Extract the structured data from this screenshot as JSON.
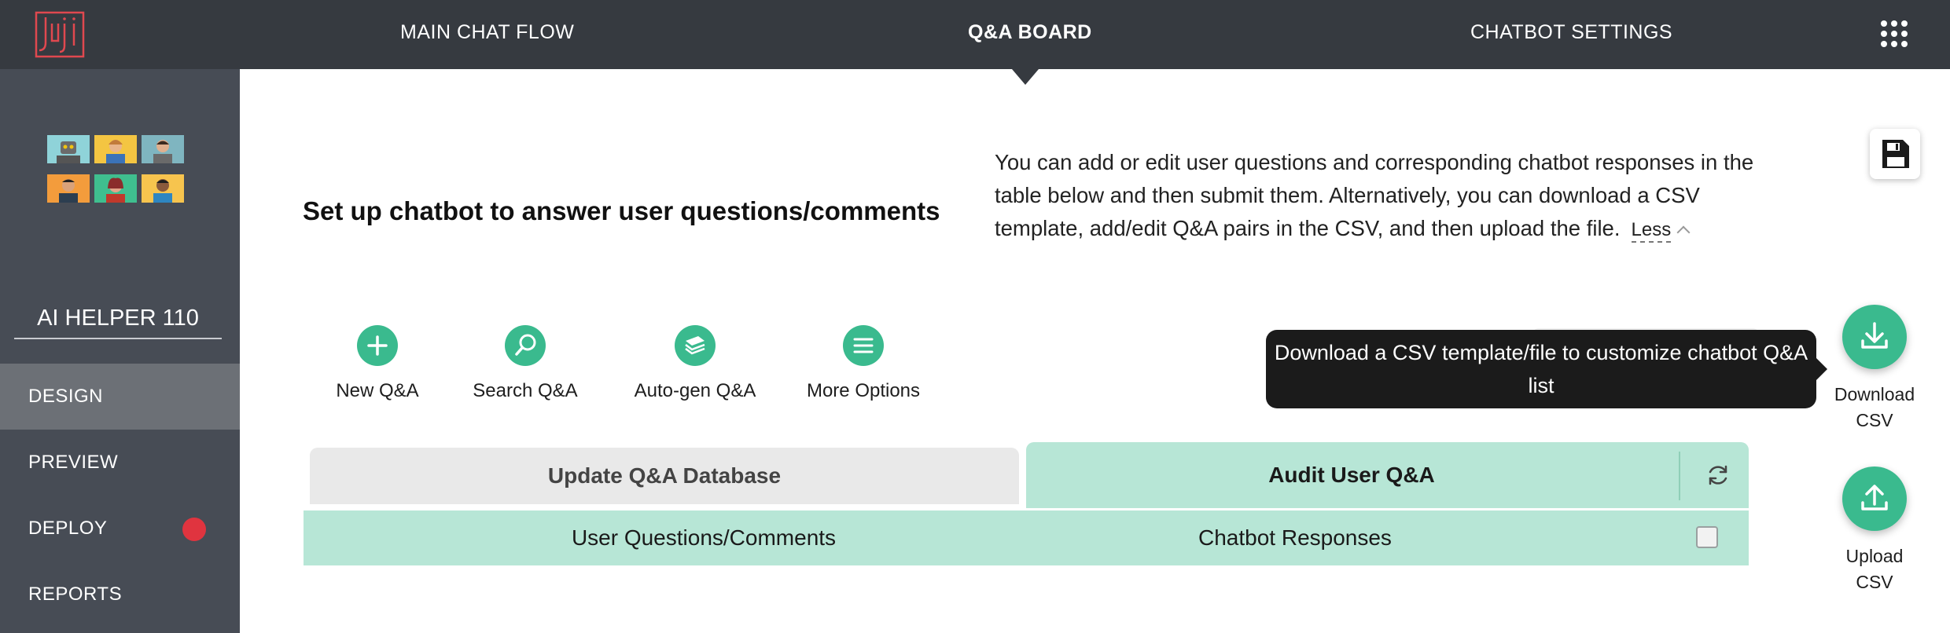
{
  "topbar": {
    "logo_text": "Juji",
    "nav": [
      {
        "label": "MAIN CHAT FLOW"
      },
      {
        "label": "Q&A BOARD"
      },
      {
        "label": "CHATBOT SETTINGS"
      }
    ]
  },
  "sidebar": {
    "bot_name": "AI HELPER 110",
    "items": [
      {
        "label": "DESIGN"
      },
      {
        "label": "PREVIEW"
      },
      {
        "label": "DEPLOY"
      },
      {
        "label": "REPORTS"
      }
    ]
  },
  "main": {
    "heading": "Set up chatbot to answer user questions/comments",
    "description": "You can add or edit user questions and corresponding chatbot responses in the table below and then submit them. Alternatively, you can download a CSV template, add/edit Q&A pairs in the CSV, and then upload the file.",
    "less_label": "Less",
    "tools": [
      {
        "label": "New Q&A",
        "icon": "plus-icon"
      },
      {
        "label": "Search Q&A",
        "icon": "search-icon"
      },
      {
        "label": "Auto-gen Q&A",
        "icon": "stack-icon"
      },
      {
        "label": "More Options",
        "icon": "menu-icon"
      }
    ],
    "tooltip": "Download a CSV template/file to customize chatbot Q&A list",
    "download_csv": {
      "line1": "Download",
      "line2": "CSV"
    },
    "upload_csv": {
      "line1": "Upload",
      "line2": "CSV"
    },
    "tabs": {
      "update": "Update Q&A Database",
      "audit": "Audit User Q&A"
    },
    "table": {
      "columns": [
        "User Questions/Comments",
        "Chatbot Responses"
      ]
    }
  },
  "colors": {
    "topbar": "#363a40",
    "sidebar": "#474c55",
    "accent_green": "#3aba8e",
    "light_green": "#b7e6d6",
    "deploy_badge": "#e0343f"
  }
}
